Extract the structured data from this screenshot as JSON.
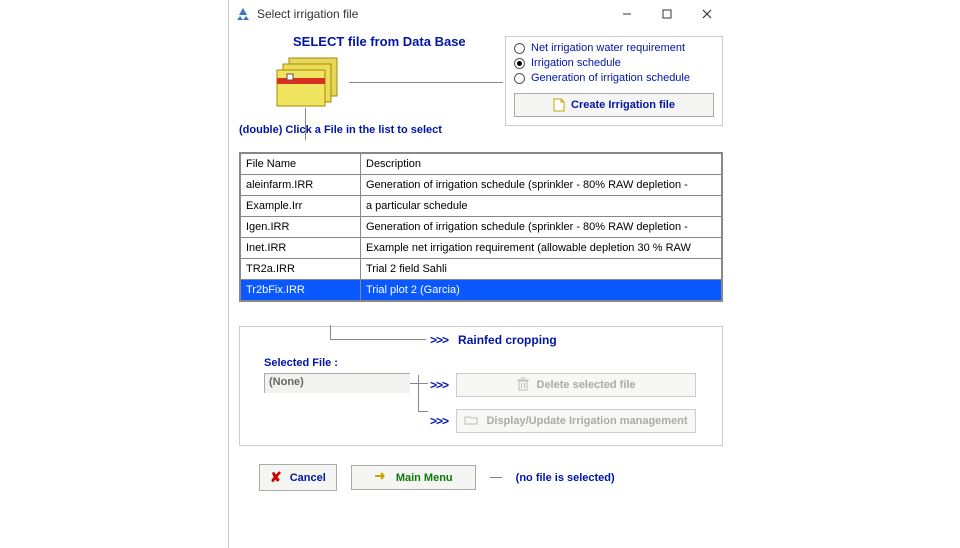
{
  "window": {
    "title": "Select irrigation file"
  },
  "top": {
    "heading": "SELECT file from Data Base",
    "instruction": "(double) Click a File in the list to select"
  },
  "options": {
    "r1": "Net irrigation water requirement",
    "r2": "Irrigation schedule",
    "r3": "Generation of irrigation schedule",
    "create_label": "Create Irrigation file"
  },
  "table": {
    "col1": "File Name",
    "col2": "Description",
    "rows": [
      {
        "name": "aleinfarm.IRR",
        "desc": "Generation of irrigation schedule (sprinkler - 80% RAW depletion -"
      },
      {
        "name": "Example.Irr",
        "desc": "a particular schedule"
      },
      {
        "name": "Igen.IRR",
        "desc": "Generation of irrigation schedule (sprinkler - 80% RAW depletion -"
      },
      {
        "name": "Inet.IRR",
        "desc": "Example net irrigation requirement (allowable depletion 30 % RAW"
      },
      {
        "name": "TR2a.IRR",
        "desc": "Trial 2 field Sahli"
      },
      {
        "name": "Tr2bFix.IRR",
        "desc": "Trial plot 2 (Garcia)"
      }
    ],
    "selected_index": 5
  },
  "lower": {
    "rainfed": "Rainfed cropping",
    "selected_label": "Selected File :",
    "selected_value": "(None)",
    "delete_label": "Delete selected file",
    "display_label": "Display/Update Irrigation management",
    "arrow": ">>>"
  },
  "bottom": {
    "cancel": "Cancel",
    "main": "Main Menu",
    "status": "(no file is selected)"
  }
}
